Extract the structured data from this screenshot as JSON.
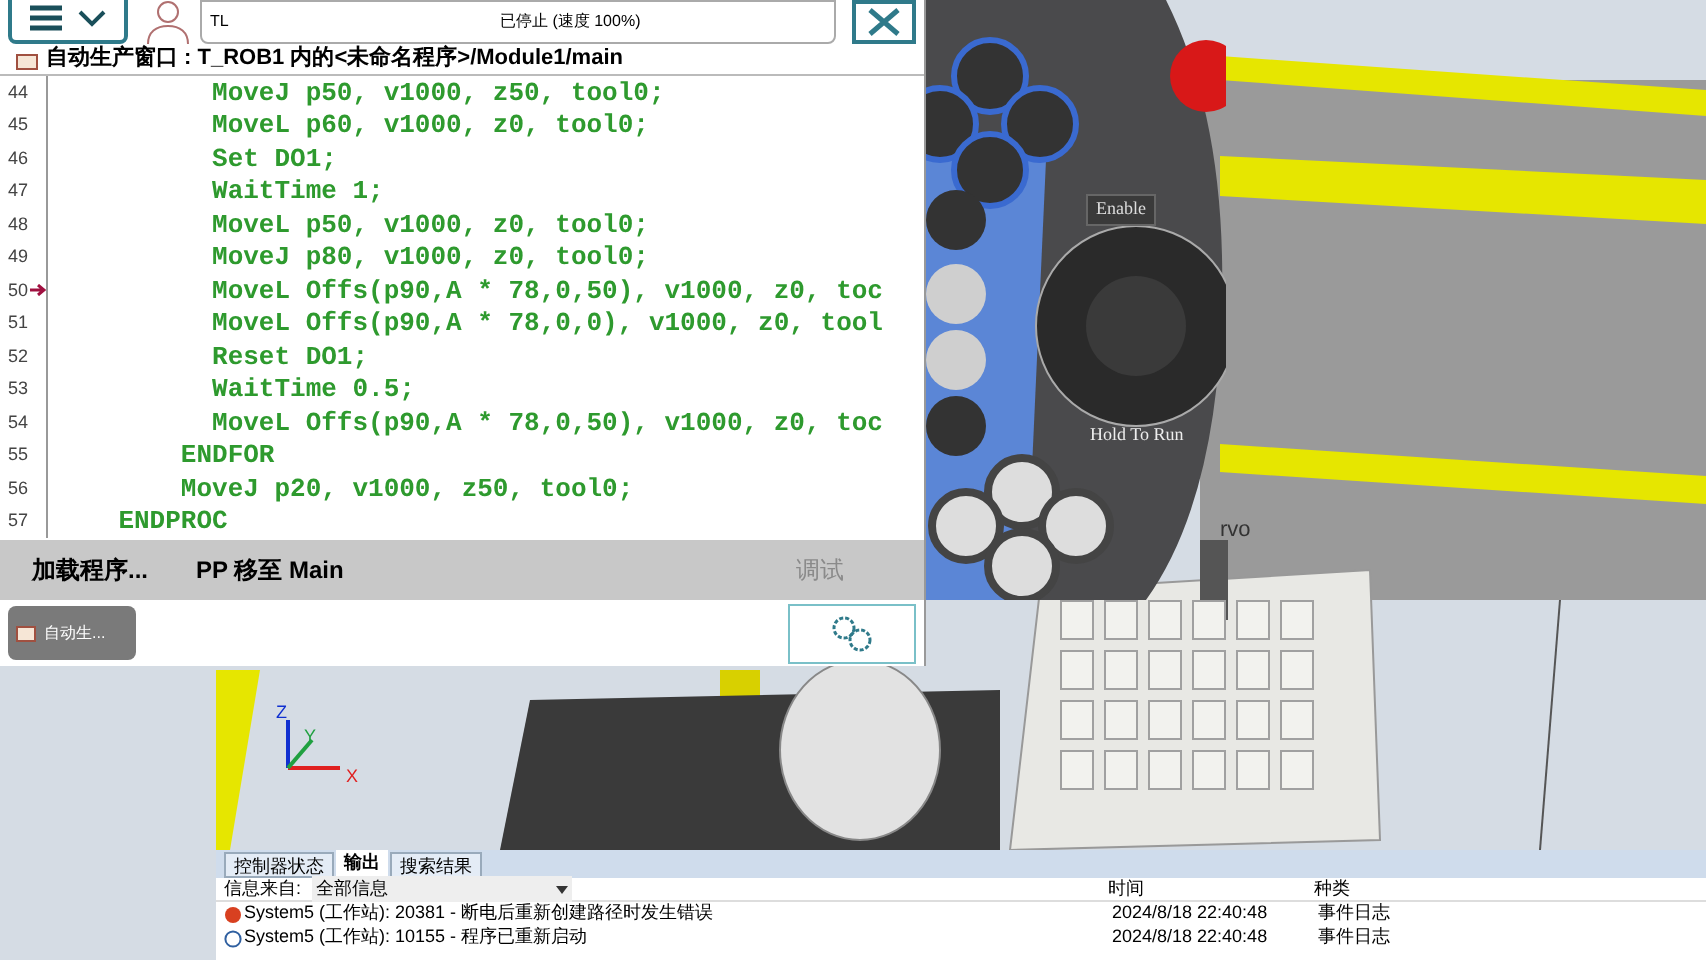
{
  "pendant": {
    "status": {
      "mode": "TL",
      "state": "已停止 (速度 100%)"
    },
    "header": "自动生产窗口 : T_ROB1 内的<未命名程序>/Module1/main",
    "code_lines": [
      {
        "number": "44",
        "text": "          MoveJ p50, v1000, z50, tool0;",
        "program_pointer": false
      },
      {
        "number": "45",
        "text": "          MoveL p60, v1000, z0, tool0;",
        "program_pointer": false
      },
      {
        "number": "46",
        "text": "          Set DO1;",
        "program_pointer": false
      },
      {
        "number": "47",
        "text": "          WaitTime 1;",
        "program_pointer": false
      },
      {
        "number": "48",
        "text": "          MoveL p50, v1000, z0, tool0;",
        "program_pointer": false
      },
      {
        "number": "49",
        "text": "          MoveJ p80, v1000, z0, tool0;",
        "program_pointer": false
      },
      {
        "number": "50",
        "text": "          MoveL Offs(p90,A * 78,0,50), v1000, z0, toc",
        "program_pointer": true
      },
      {
        "number": "51",
        "text": "          MoveL Offs(p90,A * 78,0,0), v1000, z0, tool",
        "program_pointer": false
      },
      {
        "number": "52",
        "text": "          Reset DO1;",
        "program_pointer": false
      },
      {
        "number": "53",
        "text": "          WaitTime 0.5;",
        "program_pointer": false
      },
      {
        "number": "54",
        "text": "          MoveL Offs(p90,A * 78,0,50), v1000, z0, toc",
        "program_pointer": false
      },
      {
        "number": "55",
        "text": "        ENDFOR",
        "program_pointer": false
      },
      {
        "number": "56",
        "text": "        MoveJ p20, v1000, z50, tool0;",
        "program_pointer": false
      },
      {
        "number": "57",
        "text": "    ENDPROC",
        "program_pointer": false
      }
    ],
    "toolbar": [
      {
        "label": "加载程序...",
        "disabled": false
      },
      {
        "label": "PP 移至 Main",
        "disabled": false
      },
      {
        "label": "调试",
        "disabled": true
      }
    ],
    "taskbar": {
      "app_button": "自动生..."
    }
  },
  "hardware": {
    "enable_label": "Enable",
    "hold_label": "Hold To Run"
  },
  "viewport": {
    "servo_label": "rvo",
    "axes": [
      "X",
      "Y",
      "Z"
    ]
  },
  "output": {
    "tabs": [
      {
        "label": "控制器状态",
        "selected": false
      },
      {
        "label": "输出",
        "selected": true
      },
      {
        "label": "搜索结果",
        "selected": false
      }
    ],
    "filter_label": "信息来自:",
    "filter_value": "全部信息",
    "columns": [
      "时间",
      "种类"
    ],
    "rows": [
      {
        "kind": "error",
        "message": "System5 (工作站): 20381 - 断电后重新创建路径时发生错误",
        "time": "2024/8/18 22:40:48",
        "category": "事件日志"
      },
      {
        "kind": "info",
        "message": "System5 (工作站): 10155 - 程序已重新启动",
        "time": "2024/8/18 22:40:48",
        "category": "事件日志"
      }
    ]
  }
}
